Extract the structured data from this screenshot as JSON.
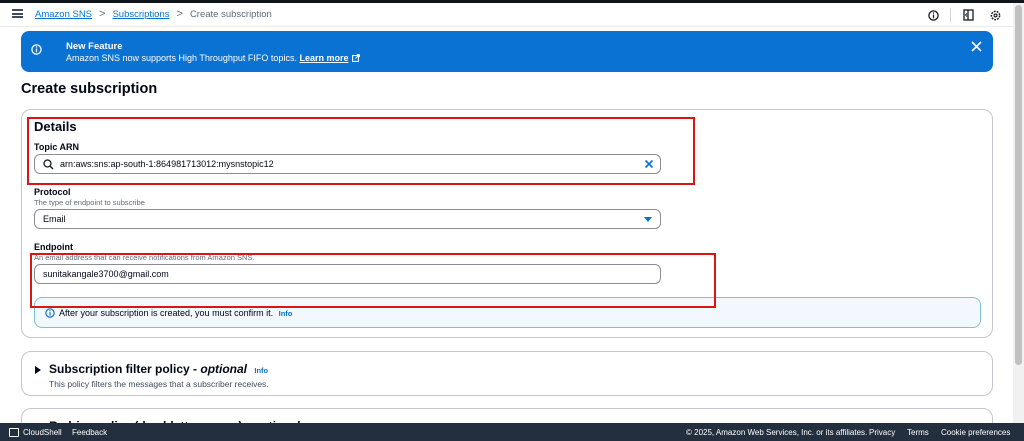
{
  "breadcrumb": {
    "items": [
      "Amazon SNS",
      "Subscriptions"
    ],
    "separator": ">",
    "current": "Create subscription"
  },
  "flash": {
    "title": "New Feature",
    "text": "Amazon SNS now supports High Throughput FIFO topics.",
    "link": "Learn more"
  },
  "page_title": "Create subscription",
  "details": {
    "heading": "Details",
    "topic_arn_label": "Topic ARN",
    "topic_arn_value": "arn:aws:sns:ap-south-1:864981713012:mysnstopic12",
    "protocol_label": "Protocol",
    "protocol_desc": "The type of endpoint to subscribe",
    "protocol_value": "Email",
    "endpoint_label": "Endpoint",
    "endpoint_desc": "An email address that can receive notifications from Amazon SNS.",
    "endpoint_value": "sunitakangale3700@gmail.com",
    "alert_text": "After your subscription is created, you must confirm it.",
    "alert_link": "Info"
  },
  "filter_policy": {
    "title": "Subscription filter policy -",
    "title_optional": "optional",
    "info": "Info",
    "desc": "This policy filters the messages that a subscriber receives."
  },
  "redrive_policy": {
    "title": "Redrive policy (dead-letter queue) -",
    "title_optional": "optional"
  },
  "footer": {
    "cloudshell": "CloudShell",
    "feedback": "Feedback",
    "copyright": "© 2025, Amazon Web Services, Inc. or its affiliates.",
    "privacy": "Privacy",
    "terms": "Terms",
    "cookie": "Cookie preferences"
  },
  "colors": {
    "link": "#0972d3",
    "flash_bg": "#0972d3",
    "highlight": "#d91515",
    "footer_bg": "#232f3e"
  },
  "icons": {
    "menu": "hamburger-icon",
    "help": "info-circle-icon",
    "panel": "panel-toggle-icon",
    "settings": "gear-icon",
    "search": "search-icon",
    "clear": "close-icon",
    "dropdown": "caret-down-icon",
    "external": "external-link-icon"
  }
}
